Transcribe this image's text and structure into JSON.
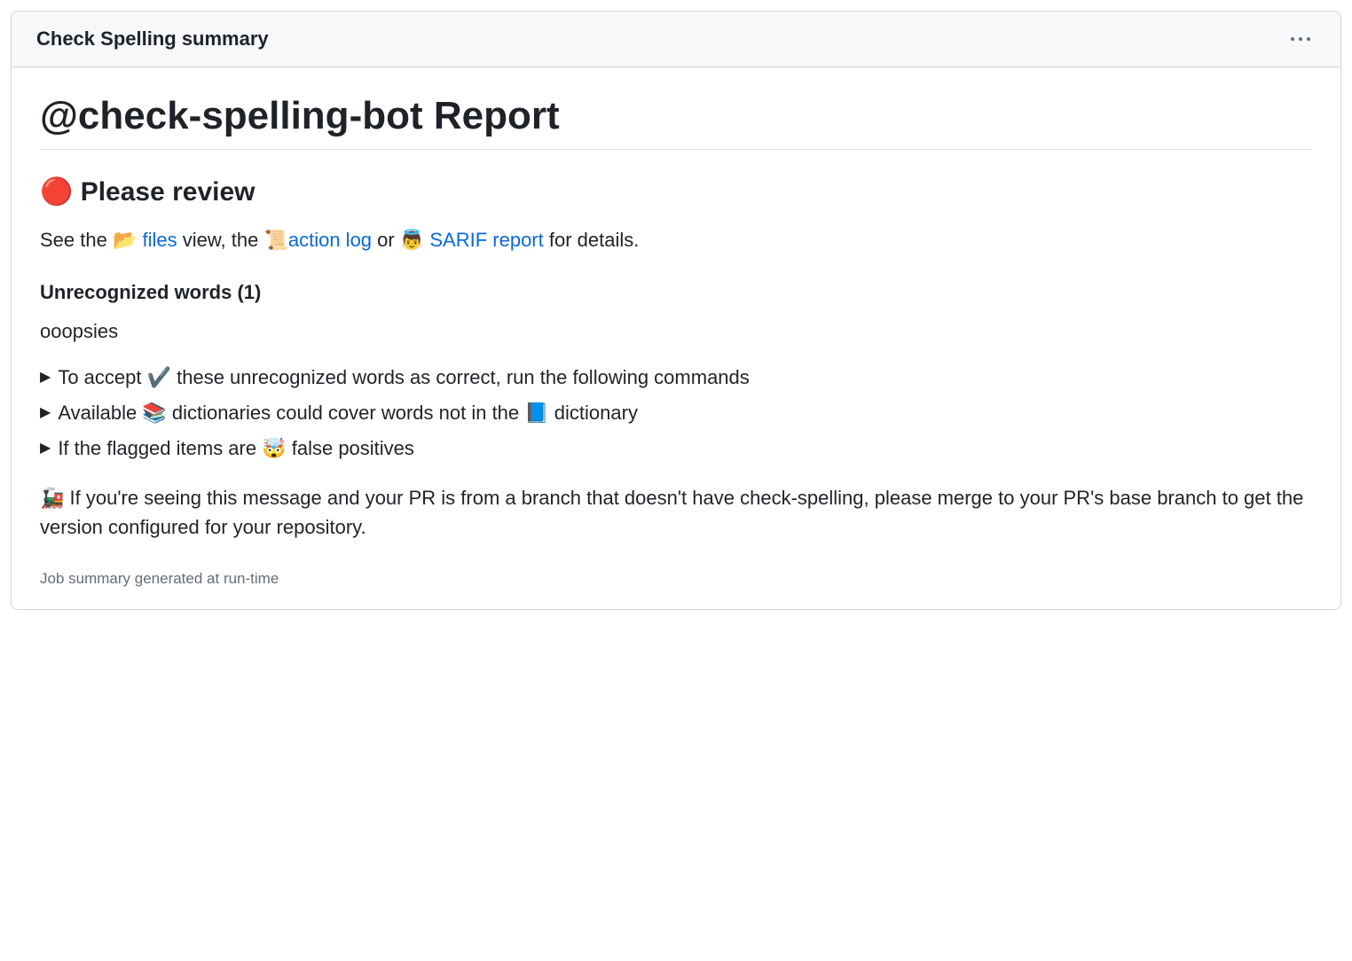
{
  "header": {
    "title": "Check Spelling summary"
  },
  "report": {
    "title": "@check-spelling-bot Report",
    "review_heading_emoji": "🔴",
    "review_heading_text": "Please review",
    "see_line": {
      "prefix": "See the ",
      "folder_emoji": "📂",
      "files_link": "files",
      "mid1": " view, the ",
      "scroll_emoji": "📜",
      "action_log_link": "action log",
      "mid2": " or ",
      "angel_emoji": "👼",
      "sarif_link": "SARIF report",
      "suffix": " for details."
    },
    "unrecognized_heading": "Unrecognized words (1)",
    "unrecognized_words": [
      "ooopsies"
    ],
    "details": [
      {
        "pre": "To accept ",
        "emoji": "✔️",
        "post": " these unrecognized words as correct, run the following commands"
      },
      {
        "pre": "Available ",
        "emoji": "📚",
        "post1": " dictionaries could cover words not in the ",
        "emoji2": "📘",
        "post2": " dictionary"
      },
      {
        "pre": "If the flagged items are ",
        "emoji": "🤯",
        "post": " false positives"
      }
    ],
    "train_note": {
      "emoji": "🚂",
      "text": " If you're seeing this message and your PR is from a branch that doesn't have check-spelling, please merge to your PR's base branch to get the version configured for your repository."
    }
  },
  "footer": {
    "text": "Job summary generated at run-time"
  }
}
